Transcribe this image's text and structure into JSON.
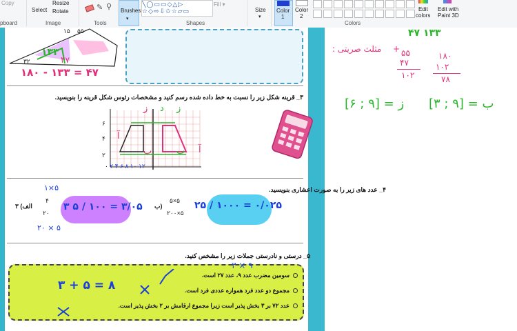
{
  "ribbon": {
    "copy": "Copy",
    "resize": "Resize",
    "select": "Select",
    "rotate": "Rotate",
    "brushes": "Brushes",
    "size": "Size",
    "color1": "Color\n1",
    "color1_a": "Color",
    "color1_b": "1",
    "color2_a": "Color",
    "color2_b": "2",
    "edit_colors_a": "Edit",
    "edit_colors_b": "colors",
    "edit_3d_a": "Edit with",
    "edit_3d_b": "Paint 3D",
    "groups": {
      "clipboard": "pboard",
      "image": "Image",
      "tools": "Tools",
      "shapes": "Shapes",
      "colors": "Colors"
    },
    "color1_value": "#1e3fd0",
    "color2_value": "#ffffff"
  },
  "worksheet": {
    "triangle": {
      "angle_top": "۱۵",
      "angle_top2": "۵۵",
      "angle_left": "۳۲",
      "hand_angles": "۱۳۳",
      "equation": "۱۸۰ - ۱۳۳ = ۴۷",
      "pink_label": "۴۷"
    },
    "q3": {
      "text": "۳_ قرینه شکل زیر را نسبت به خط داده شده رسم کنید و مشخصات رئوس شکل قرینه را بنویسید.",
      "x_ticks": [
        "۰",
        "۲",
        "۴",
        "۶",
        "۸",
        "۱۰",
        "۱۲"
      ],
      "y_ticks": [
        "۲",
        "۴",
        "۶"
      ],
      "hand_labels": [
        "ز",
        "د",
        "ز",
        "ب",
        "آ",
        "ب",
        "آ"
      ]
    },
    "q4": {
      "text": "۴_ عدد های زیر را به صورت اعشاری بنویسید.",
      "part_a": "الف) ۳",
      "part_b": "ب)",
      "frac_a_top": "۴",
      "frac_a_bottom": "۲۰",
      "hand_a_top": "۱×۵",
      "hand_a_bottom": "۲۰ × ۵",
      "hand_a_result": "۳ ۵ / ۱۰۰ = ۳/۰۵",
      "frac_b_top": "۵×۵",
      "frac_b_bottom": "۲۰۰×۵",
      "hand_b_result": "۲۵ / ۱۰۰۰ = ۰/۰۲۵"
    },
    "q5": {
      "text": "۵_ درستی و نادرستی جملات زیر را مشخص کنید.",
      "items": [
        "سومین مضرب عدد ۹، عدد ۲۷ است.",
        "مجموع دو عدد فرد همواره عددی فرد است.",
        "عدد ۷۲ بر ۳ بخش پذیر است زیرا مجموع ارقامش بر ۲ بخش پذیر است."
      ],
      "hand_equation": "۳ + ۵ = ۸",
      "hand_above": "۳ × ۹"
    }
  },
  "notes": {
    "pink_title": "مثلث صریتی :",
    "pink_sum_top": "۵۵",
    "pink_sum_plus": "+",
    "pink_sum_mid": "۴۷",
    "pink_sum_result": "۱۰۲",
    "pink_sub_top": "۱۸۰",
    "pink_sub_mid": "۱۰۲",
    "pink_sub_result": "۷۸",
    "green_left": "ز = [۹ ; ۶]",
    "green_right": "ب = [۹ ; ۳]",
    "green_top": "۴۷      ۱۳۳"
  }
}
